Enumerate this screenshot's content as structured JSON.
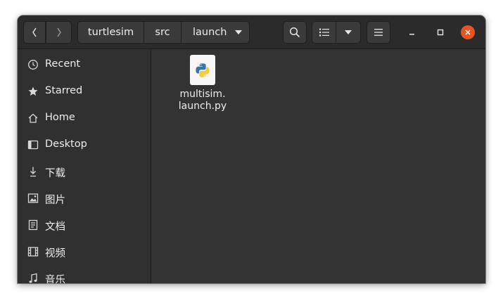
{
  "path": {
    "segments": [
      "turtlesim",
      "src",
      "launch"
    ]
  },
  "sidebar": {
    "items": [
      {
        "label": "Recent",
        "icon": "clock-icon"
      },
      {
        "label": "Starred",
        "icon": "star-icon"
      },
      {
        "label": "Home",
        "icon": "home-icon"
      },
      {
        "label": "Desktop",
        "icon": "desktop-icon"
      },
      {
        "label": "下载",
        "icon": "download-icon"
      },
      {
        "label": "图片",
        "icon": "image-icon"
      },
      {
        "label": "文档",
        "icon": "document-icon"
      },
      {
        "label": "视频",
        "icon": "video-icon"
      },
      {
        "label": "音乐",
        "icon": "music-icon"
      }
    ]
  },
  "files": [
    {
      "name_line1": "multisim.",
      "name_line2": "launch.py",
      "icon": "python-file-icon"
    }
  ],
  "colors": {
    "close_button": "#e95420",
    "background": "#333333",
    "sidebar": "#303030"
  }
}
